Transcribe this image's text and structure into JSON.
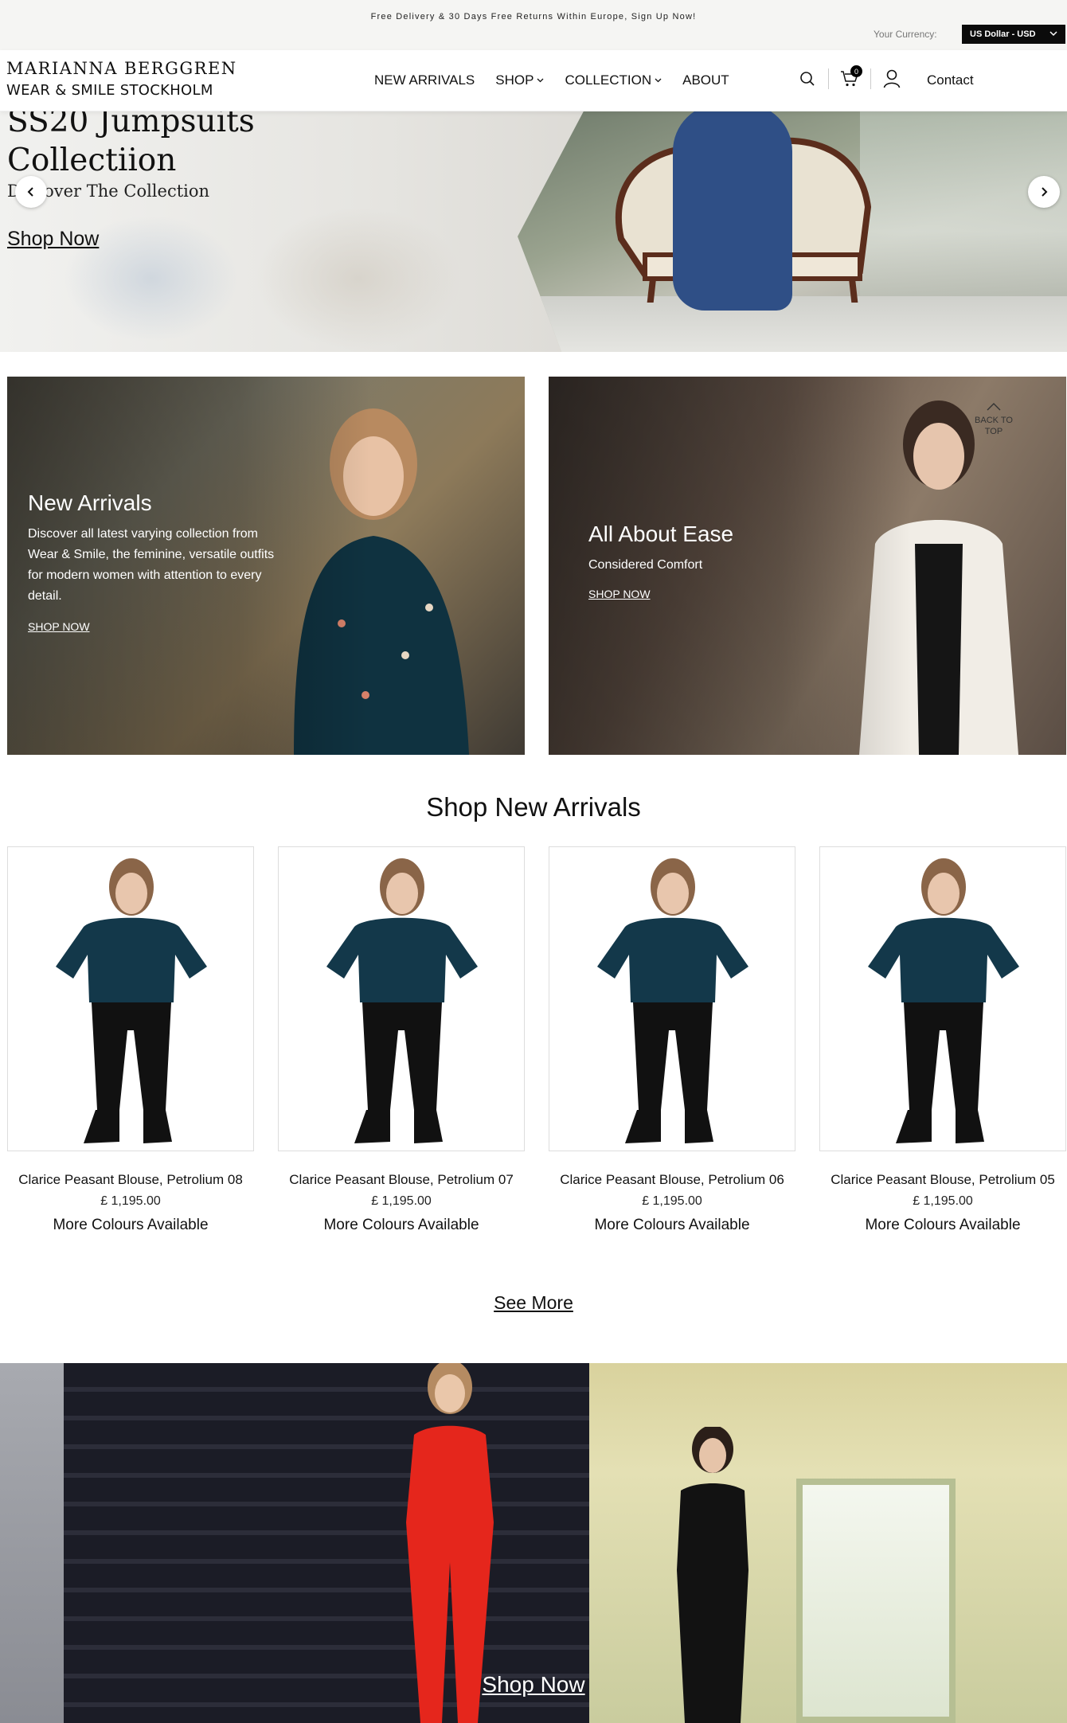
{
  "topbar": {
    "announcement": "Free Delivery & 30 Days Free Returns Within Europe, Sign Up Now!",
    "currency_label": "Your Currency:",
    "currency_value": "US Dollar - USD"
  },
  "header": {
    "logo_line1": "MARIANNA BERGGREN",
    "logo_line2": "WEAR & SMILE STOCKHOLM",
    "nav": [
      {
        "label": "NEW ARRIVALS"
      },
      {
        "label": "SHOP"
      },
      {
        "label": "COLLECTION"
      },
      {
        "label": "ABOUT"
      }
    ],
    "cart_count": "0",
    "contact": "Contact"
  },
  "hero": {
    "title_line1": "SS20 Jumpsuits",
    "title_line2": "Collectiion",
    "subtitle": "Discover The Collection",
    "cta": "Shop Now"
  },
  "promos": [
    {
      "title": "New Arrivals",
      "text": "Discover all latest varying collection from Wear & Smile, the feminine, versatile outfits for modern women with attention to every detail.",
      "link": "SHOP NOW"
    },
    {
      "title": "All About Ease",
      "text": "Considered Comfort",
      "link": "SHOP NOW"
    }
  ],
  "back_to_top": "BACK TO TOP",
  "section_title": "Shop New Arrivals",
  "products": [
    {
      "name": "Clarice Peasant Blouse, Petrolium 08",
      "price": "£ 1,195.00",
      "colours": "More Colours Available"
    },
    {
      "name": "Clarice Peasant Blouse, Petrolium 07",
      "price": "£ 1,195.00",
      "colours": "More Colours Available"
    },
    {
      "name": "Clarice Peasant Blouse, Petrolium 06",
      "price": "£ 1,195.00",
      "colours": "More Colours Available"
    },
    {
      "name": "Clarice Peasant Blouse, Petrolium 05",
      "price": "£ 1,195.00",
      "colours": "More Colours Available"
    }
  ],
  "see_more": "See More",
  "banner_cta": "Shop Now",
  "colors": {
    "accent": "#111111",
    "topbar_bg": "#f5f5f3",
    "currency_bg": "#0b0b0b",
    "blouse": "#13384a"
  }
}
